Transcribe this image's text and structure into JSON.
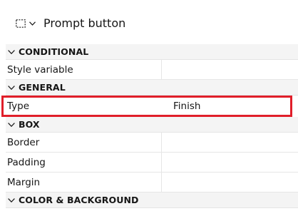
{
  "header": {
    "icon": "dashed-selection-icon",
    "title": "Prompt button"
  },
  "sections": [
    {
      "label": "CONDITIONAL",
      "rows": [
        {
          "name": "Style variable",
          "value": ""
        }
      ]
    },
    {
      "label": "GENERAL",
      "rows": [
        {
          "name": "Type",
          "value": "Finish"
        }
      ]
    },
    {
      "label": "BOX",
      "rows": [
        {
          "name": "Border",
          "value": ""
        },
        {
          "name": "Padding",
          "value": ""
        },
        {
          "name": "Margin",
          "value": ""
        }
      ]
    },
    {
      "label": "COLOR & BACKGROUND",
      "rows": []
    }
  ],
  "colors": {
    "highlight": "#e01e29",
    "section_bg": "#f4f4f4"
  }
}
